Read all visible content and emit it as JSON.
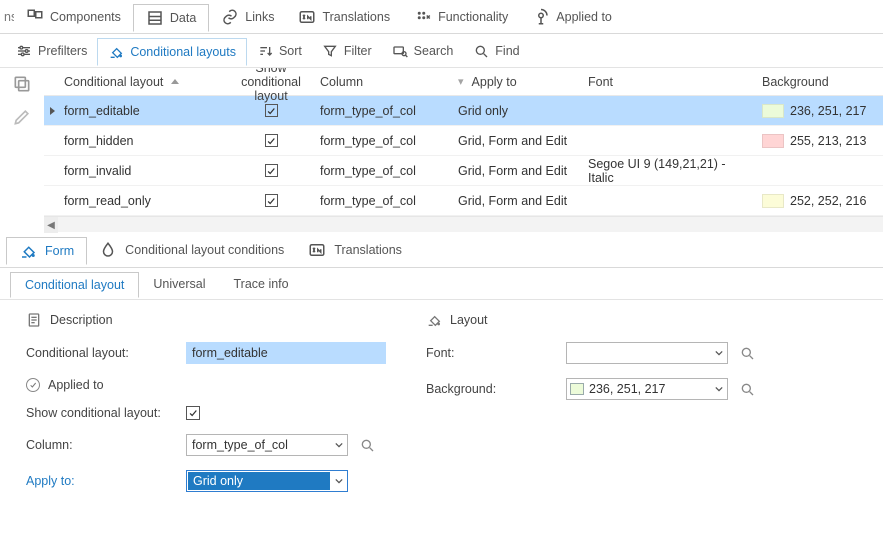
{
  "top_tabs_cut": "ns",
  "top_tabs": {
    "components": "Components",
    "data": "Data",
    "links": "Links",
    "translations": "Translations",
    "functionality": "Functionality",
    "applied_to": "Applied to"
  },
  "toolbar": {
    "prefilters": "Prefilters",
    "cond_layouts": "Conditional layouts",
    "sort": "Sort",
    "filter": "Filter",
    "search": "Search",
    "find": "Find"
  },
  "grid": {
    "headers": {
      "name": "Conditional layout",
      "show": "Show conditional layout",
      "column": "Column",
      "apply_to": "Apply to",
      "font": "Font",
      "background": "Background"
    },
    "rows": [
      {
        "name": "form_editable",
        "show": true,
        "column": "form_type_of_col",
        "apply_to": "Grid only",
        "font": "",
        "bg_color": "#ecfbd9",
        "bg_text": "236, 251, 217",
        "selected": true
      },
      {
        "name": "form_hidden",
        "show": true,
        "column": "form_type_of_col",
        "apply_to": "Grid, Form and Edit",
        "font": "",
        "bg_color": "#ffd5d5",
        "bg_text": "255, 213, 213",
        "selected": false
      },
      {
        "name": "form_invalid",
        "show": true,
        "column": "form_type_of_col",
        "apply_to": "Grid, Form and Edit",
        "font": "Segoe UI 9 (149,21,21) - Italic",
        "bg_color": "",
        "bg_text": "",
        "selected": false
      },
      {
        "name": "form_read_only",
        "show": true,
        "column": "form_type_of_col",
        "apply_to": "Grid, Form and Edit",
        "font": "",
        "bg_color": "#fcfcd8",
        "bg_text": "252, 252, 216",
        "selected": false
      }
    ]
  },
  "mid_tabs": {
    "form": "Form",
    "conditions": "Conditional layout conditions",
    "translations": "Translations"
  },
  "sub_tabs": {
    "cond_layout": "Conditional layout",
    "universal": "Universal",
    "trace": "Trace info"
  },
  "form": {
    "description_section": "Description",
    "layout_section": "Layout",
    "applied_section": "Applied to",
    "labels": {
      "cond_layout": "Conditional layout:",
      "font": "Font:",
      "background": "Background:",
      "show": "Show conditional layout:",
      "column": "Column:",
      "apply_to": "Apply to:"
    },
    "values": {
      "cond_layout": "form_editable",
      "font": "",
      "background": "236, 251, 217",
      "background_swatch": "#ecfbd9",
      "show": true,
      "column": "form_type_of_col",
      "apply_to": "Grid only"
    }
  }
}
